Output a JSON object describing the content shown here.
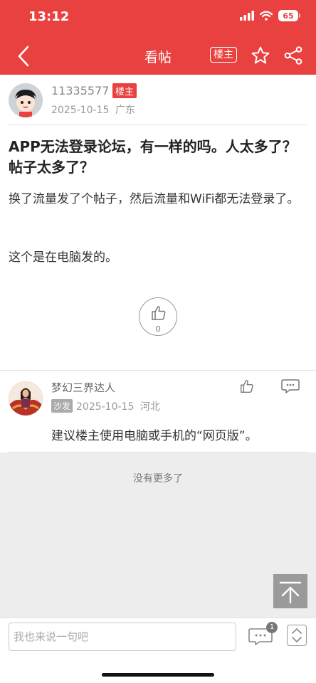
{
  "status_bar": {
    "time": "13:12",
    "battery": "65"
  },
  "nav": {
    "title": "看帖",
    "owner_label": "楼主"
  },
  "post": {
    "author": "11335577",
    "owner_badge": "楼主",
    "date": "2025-10-15",
    "location": "广东",
    "title": "APP无法登录论坛，有一样的吗。人太多了？帖子太多了？",
    "body": [
      "换了流量发了个帖子，然后流量和WiFi都无法登录了。",
      "这个是在电脑发的。"
    ],
    "like_count": "0"
  },
  "reply": {
    "author": "梦幻三界达人",
    "tag": "沙发",
    "date": "2025-10-15",
    "location": "河北",
    "text": "建议楼主使用电脑或手机的“网页版”。"
  },
  "footer": {
    "no_more": "没有更多了"
  },
  "bottom_bar": {
    "placeholder": "我也来说一句吧",
    "comment_count": "1"
  },
  "colors": {
    "brand": "#e8413f"
  }
}
